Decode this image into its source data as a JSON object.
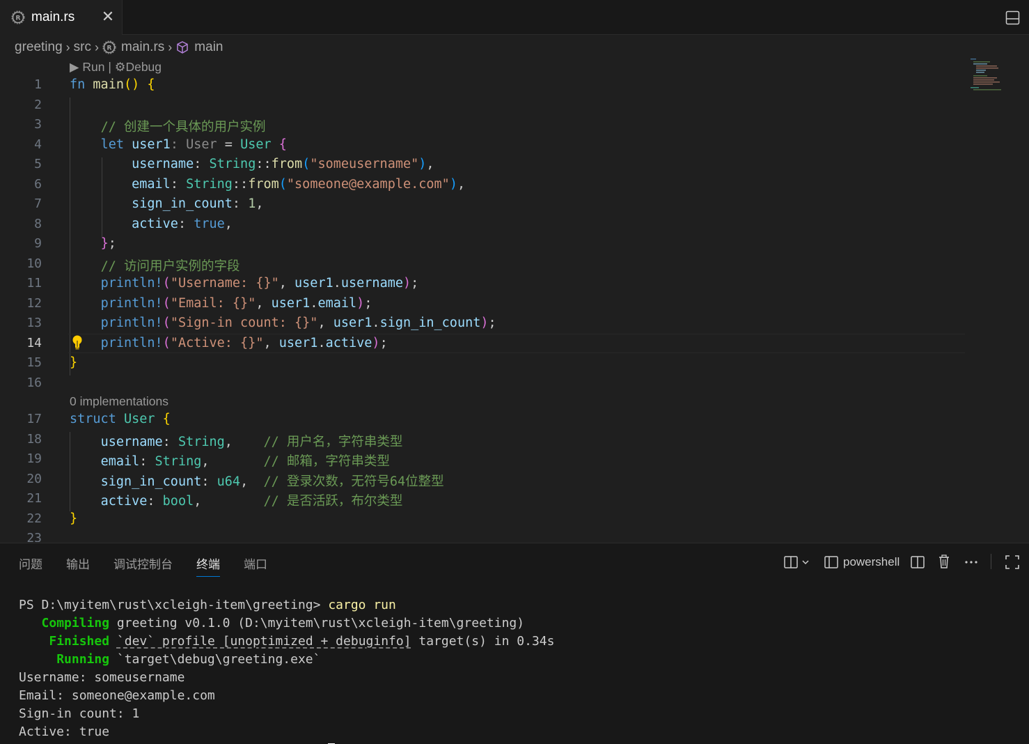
{
  "tab": {
    "filename": "main.rs",
    "close_glyph": "✕"
  },
  "breadcrumb": [
    "greeting",
    "src",
    "main.rs",
    "main"
  ],
  "codelens": {
    "run": "Run",
    "separator": "|",
    "debug": "Debug",
    "implementations": "0 implementations"
  },
  "editor": {
    "active_line": 14,
    "lines": [
      {
        "n": "1"
      },
      {
        "n": "2"
      },
      {
        "n": "3"
      },
      {
        "n": "4"
      },
      {
        "n": "5"
      },
      {
        "n": "6"
      },
      {
        "n": "7"
      },
      {
        "n": "8"
      },
      {
        "n": "9"
      },
      {
        "n": "10"
      },
      {
        "n": "11"
      },
      {
        "n": "12"
      },
      {
        "n": "13"
      },
      {
        "n": "14"
      },
      {
        "n": "15"
      },
      {
        "n": "16"
      },
      {
        "n": "17"
      },
      {
        "n": "18"
      },
      {
        "n": "19"
      },
      {
        "n": "20"
      },
      {
        "n": "21"
      },
      {
        "n": "22"
      },
      {
        "n": "23"
      }
    ],
    "code": {
      "l1": [
        "fn",
        "main",
        "()",
        " {"
      ],
      "l3": "// 创建一个具体的用户实例",
      "l4": [
        "let",
        "user1",
        ": User",
        " = ",
        "User",
        " {"
      ],
      "l5": [
        "username",
        ": ",
        "String",
        "::",
        "from",
        "(",
        "\"someusername\"",
        ")",
        ","
      ],
      "l6": [
        "email",
        ": ",
        "String",
        "::",
        "from",
        "(",
        "\"someone@example.com\"",
        ")",
        ","
      ],
      "l7": [
        "sign_in_count",
        ": ",
        "1",
        ","
      ],
      "l8": [
        "active",
        ": ",
        "true",
        ","
      ],
      "l9": [
        "}",
        ";"
      ],
      "l10": "// 访问用户实例的字段",
      "l11": [
        "println!",
        "(",
        "\"Username: {}\"",
        ", ",
        "user1",
        ".",
        "username",
        ")",
        ";"
      ],
      "l12": [
        "println!",
        "(",
        "\"Email: {}\"",
        ", ",
        "user1",
        ".",
        "email",
        ")",
        ";"
      ],
      "l13": [
        "println!",
        "(",
        "\"Sign-in count: {}\"",
        ", ",
        "user1",
        ".",
        "sign_in_count",
        ")",
        ";"
      ],
      "l14": [
        "println!",
        "(",
        "\"Active: {}\"",
        ", ",
        "user1",
        ".",
        "active",
        ")",
        ";"
      ],
      "l15": "}",
      "l17": [
        "struct",
        "User",
        " {"
      ],
      "l18": [
        "username",
        ": ",
        "String",
        ",",
        "    // 用户名，字符串类型"
      ],
      "l19": [
        "email",
        ": ",
        "String",
        ",",
        "       // 邮箱，字符串类型"
      ],
      "l20": [
        "sign_in_count",
        ": ",
        "u64",
        ",",
        "  // 登录次数，无符号64位整型"
      ],
      "l21": [
        "active",
        ": ",
        "bool",
        ",",
        "        // 是否活跃，布尔类型"
      ],
      "l22": "}"
    }
  },
  "panel": {
    "tabs": [
      "问题",
      "输出",
      "调试控制台",
      "终端",
      "端口"
    ],
    "active_tab": "终端",
    "shell_label": "powershell"
  },
  "terminal": {
    "prompt": "PS D:\\myitem\\rust\\xcleigh-item\\greeting> ",
    "command": "cargo run",
    "compiling_word": "Compiling",
    "compiling_rest": " greeting v0.1.0 (D:\\myitem\\rust\\xcleigh-item\\greeting)",
    "finished_word": "Finished",
    "finished_dev": "`dev` profile [unoptimized + debuginfo]",
    "finished_rest": " target(s) in 0.34s",
    "running_word": "Running",
    "running_rest": " `target\\debug\\greeting.exe`",
    "out1": "Username: someusername",
    "out2": "Email: someone@example.com",
    "out3": "Sign-in count: 1",
    "out4": "Active: true"
  },
  "colors": {
    "keyword": "#569cd6",
    "function": "#dcdcaa",
    "type": "#4ec9b0",
    "string": "#ce9178",
    "comment": "#6a9955",
    "variable": "#9cdcfe",
    "terminal_green": "#16c60c",
    "accent": "#0078d4"
  },
  "icons": {
    "tab": "rust-icon",
    "close": "close-icon",
    "layout": "toggle-panel-icon",
    "breadcrumb_file": "rust-icon",
    "breadcrumb_symbol": "cube-icon",
    "lightbulb": "lightbulb-icon",
    "panel_actions": [
      "split-terminal-icon",
      "chevron-down-icon",
      "terminal-icon",
      "split-editor-icon",
      "trash-icon",
      "more-icon",
      "maximize-icon"
    ]
  }
}
